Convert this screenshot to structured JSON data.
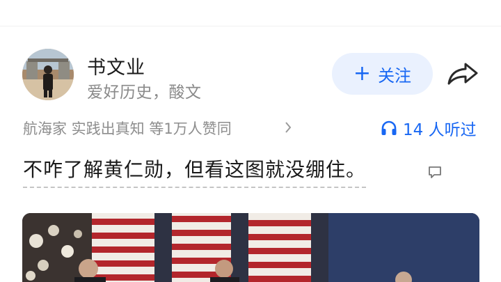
{
  "author": {
    "name": "书文业",
    "bio": "爱好历史，酸文",
    "avatar_icon": "avatar-photo"
  },
  "actions": {
    "follow_label": "关注",
    "follow_icon": "plus-icon",
    "share_icon": "share-arrow-icon"
  },
  "meta": {
    "endorsement": "航海家 实践出真知 等1万人赞同",
    "chevron_icon": "chevron-right-icon",
    "listen_label": "14 人听过",
    "listen_icon": "headphone-icon"
  },
  "content": {
    "question": "不咋了解黄仁勋，但看这图就没绷住。",
    "comment_icon": "comment-icon"
  },
  "colors": {
    "accent": "#1867f3",
    "follow_bg": "#eaf1fe",
    "muted_text": "#8a8a8a",
    "primary_text": "#1a1a1a"
  }
}
